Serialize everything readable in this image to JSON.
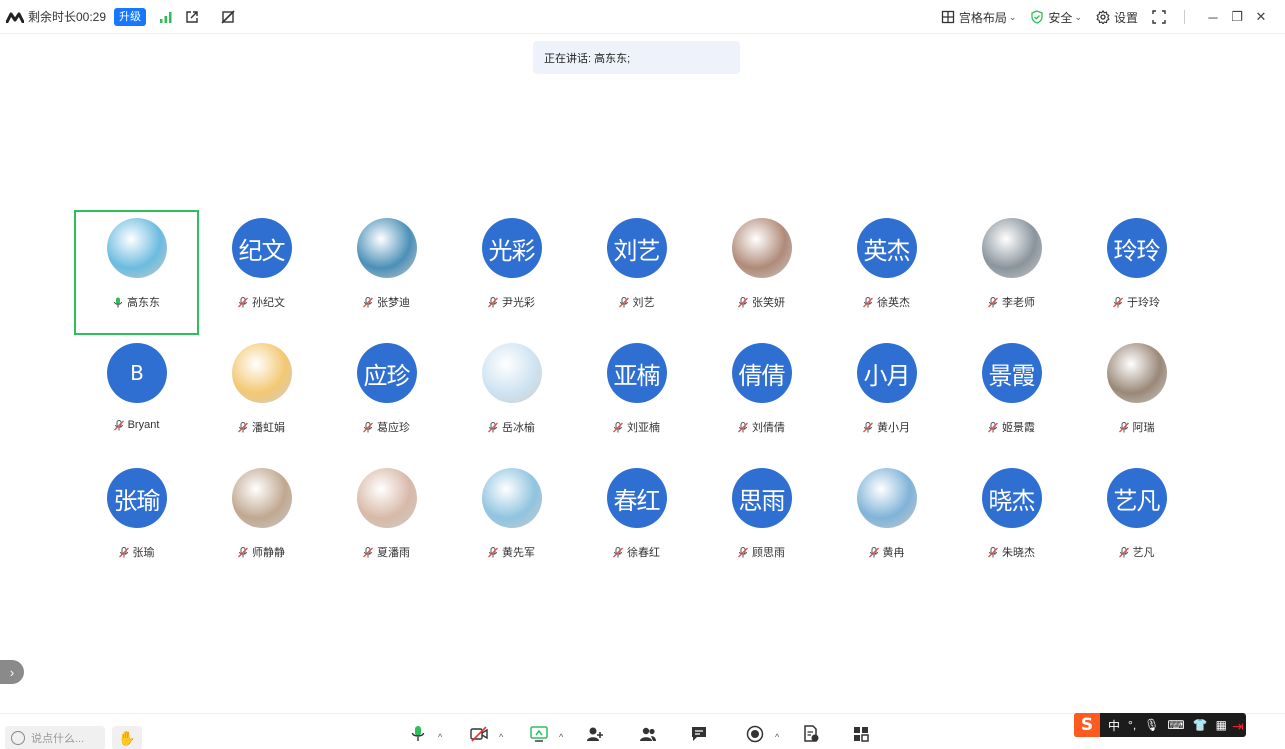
{
  "topbar": {
    "remaining_time": "剩余时长00:29",
    "upgrade_label": "升级",
    "layout_label": "宫格布局",
    "security_label": "安全",
    "settings_label": "设置"
  },
  "speaking": {
    "text": "正在讲话: 高东东;"
  },
  "participants": [
    {
      "name": "高东东",
      "avatar": "pic",
      "avatar_text": "",
      "color": "#6bbbe0",
      "mic": "green"
    },
    {
      "name": "孙纪文",
      "avatar": "text",
      "avatar_text": "纪文",
      "mic": "muted"
    },
    {
      "name": "张梦迪",
      "avatar": "pic",
      "avatar_text": "",
      "color": "#4a90b8",
      "mic": "muted"
    },
    {
      "name": "尹光彩",
      "avatar": "text",
      "avatar_text": "光彩",
      "mic": "muted"
    },
    {
      "name": "刘艺",
      "avatar": "text",
      "avatar_text": "刘艺",
      "mic": "muted"
    },
    {
      "name": "张笑妍",
      "avatar": "pic",
      "avatar_text": "",
      "color": "#b08a78",
      "mic": "muted"
    },
    {
      "name": "徐英杰",
      "avatar": "text",
      "avatar_text": "英杰",
      "mic": "muted"
    },
    {
      "name": "李老师",
      "avatar": "pic",
      "avatar_text": "",
      "color": "#8a949c",
      "mic": "muted"
    },
    {
      "name": "于玲玲",
      "avatar": "text",
      "avatar_text": "玲玲",
      "mic": "muted"
    },
    {
      "name": "Bryant",
      "avatar": "text",
      "avatar_text": "B",
      "mic": "muted"
    },
    {
      "name": "潘虹娟",
      "avatar": "pic",
      "avatar_text": "",
      "color": "#f3c873",
      "mic": "muted"
    },
    {
      "name": "葛应珍",
      "avatar": "text",
      "avatar_text": "应珍",
      "mic": "muted"
    },
    {
      "name": "岳冰榆",
      "avatar": "pic",
      "avatar_text": "",
      "color": "#cfe3f2",
      "mic": "muted"
    },
    {
      "name": "刘亚楠",
      "avatar": "text",
      "avatar_text": "亚楠",
      "mic": "muted"
    },
    {
      "name": "刘倩倩",
      "avatar": "text",
      "avatar_text": "倩倩",
      "mic": "muted"
    },
    {
      "name": "黄小月",
      "avatar": "text",
      "avatar_text": "小月",
      "mic": "muted"
    },
    {
      "name": "姬景霞",
      "avatar": "text",
      "avatar_text": "景霞",
      "mic": "muted"
    },
    {
      "name": "阿瑞",
      "avatar": "pic",
      "avatar_text": "",
      "color": "#9a8878",
      "mic": "muted"
    },
    {
      "name": "张瑜",
      "avatar": "text",
      "avatar_text": "张瑜",
      "mic": "muted"
    },
    {
      "name": "师静静",
      "avatar": "pic",
      "avatar_text": "",
      "color": "#c0a890",
      "mic": "muted"
    },
    {
      "name": "夏潘雨",
      "avatar": "pic",
      "avatar_text": "",
      "color": "#d8b9a8",
      "mic": "muted"
    },
    {
      "name": "黄先军",
      "avatar": "pic",
      "avatar_text": "",
      "color": "#8fc4e0",
      "mic": "muted"
    },
    {
      "name": "徐春红",
      "avatar": "text",
      "avatar_text": "春红",
      "mic": "muted"
    },
    {
      "name": "顾思雨",
      "avatar": "text",
      "avatar_text": "思雨",
      "mic": "muted"
    },
    {
      "name": "黄冉",
      "avatar": "pic",
      "avatar_text": "",
      "color": "#7fb3d8",
      "mic": "muted"
    },
    {
      "name": "朱晓杰",
      "avatar": "text",
      "avatar_text": "晓杰",
      "mic": "muted"
    },
    {
      "name": "艺凡",
      "avatar": "text",
      "avatar_text": "艺凡",
      "mic": "muted"
    }
  ],
  "bottombar": {
    "chat_placeholder": "说点什么...",
    "ime_text": "中"
  },
  "colors": {
    "accent": "#2e6fd1",
    "active_border": "#2dbf5b",
    "muted_mic": "#e05050"
  }
}
